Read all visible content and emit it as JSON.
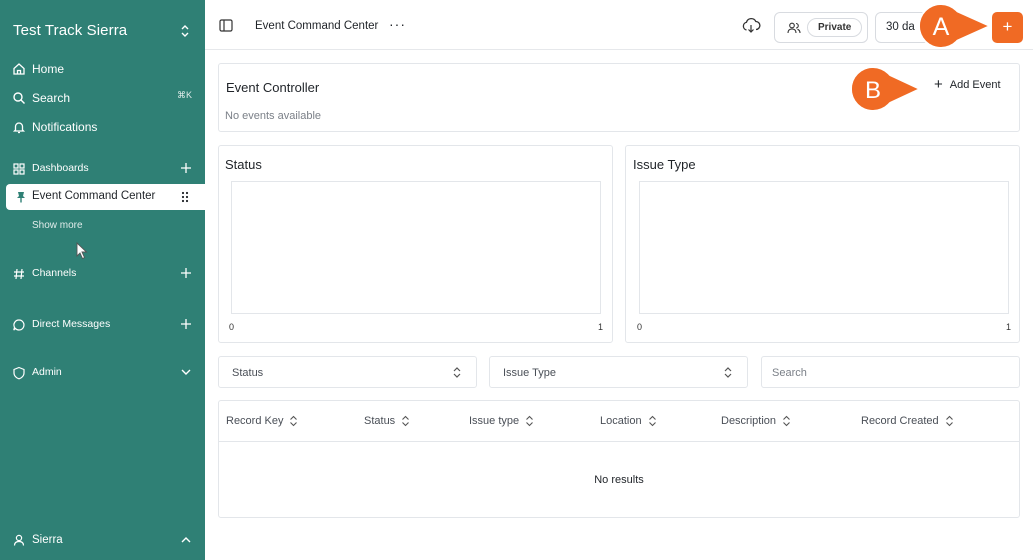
{
  "sidebar": {
    "workspace_title": "Test Track Sierra",
    "nav": [
      {
        "label": "Home",
        "icon": "home-icon"
      },
      {
        "label": "Search",
        "icon": "search-icon",
        "shortcut": "⌘K"
      },
      {
        "label": "Notifications",
        "icon": "bell-icon"
      }
    ],
    "dashboards_label": "Dashboards",
    "active_item": "Event Command Center",
    "show_more": "Show more",
    "channels_label": "Channels",
    "direct_messages_label": "Direct Messages",
    "admin_label": "Admin",
    "user_label": "Sierra"
  },
  "topbar": {
    "breadcrumb": "Event Command Center",
    "more": "···",
    "private_label": "Private",
    "date_range": "30 da",
    "add": "+"
  },
  "callouts": {
    "a": "A",
    "b": "B"
  },
  "event_controller": {
    "title": "Event Controller",
    "empty": "No events available",
    "add_event": "Add Event"
  },
  "status_chart": {
    "title": "Status",
    "tick_min": "0",
    "tick_max": "1"
  },
  "issue_chart": {
    "title": "Issue Type",
    "tick_min": "0",
    "tick_max": "1"
  },
  "chart_data": [
    {
      "type": "bar",
      "title": "Status",
      "categories": [],
      "values": [],
      "xlim": [
        0,
        1
      ]
    },
    {
      "type": "bar",
      "title": "Issue Type",
      "categories": [],
      "values": [],
      "xlim": [
        0,
        1
      ]
    }
  ],
  "filters": {
    "status": "Status",
    "issue_type": "Issue Type",
    "search_placeholder": "Search"
  },
  "table": {
    "columns": [
      "Record Key",
      "Status",
      "Issue type",
      "Location",
      "Description",
      "Record Created"
    ],
    "empty": "No results"
  },
  "colors": {
    "sidebar_bg": "#2f8075",
    "accent": "#f06a24"
  }
}
